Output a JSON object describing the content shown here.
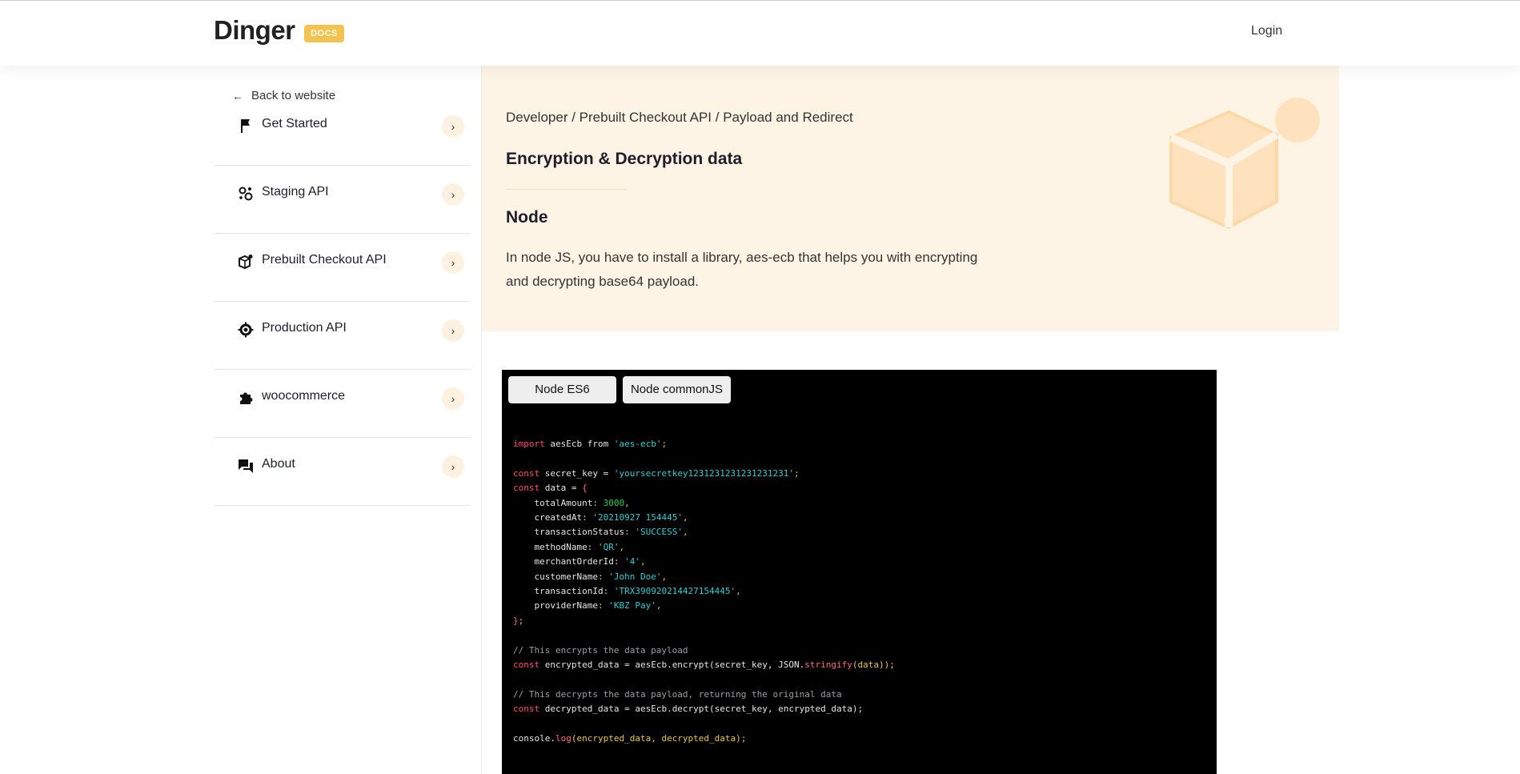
{
  "header": {
    "brand": "Dinger",
    "badge": "DOCS",
    "login": "Login"
  },
  "sidebar": {
    "back": "Back to website",
    "items": [
      {
        "label": "Get Started",
        "icon": "flag-icon"
      },
      {
        "label": "Staging API",
        "icon": "gears-icon"
      },
      {
        "label": "Prebuilt Checkout API",
        "icon": "package-icon"
      },
      {
        "label": "Production API",
        "icon": "gear-icon"
      },
      {
        "label": "woocommerce",
        "icon": "puzzle-icon"
      },
      {
        "label": "About",
        "icon": "chat-icon"
      }
    ]
  },
  "hero": {
    "breadcrumb": "Developer / Prebuilt Checkout API / Payload and Redirect",
    "title": "Encryption & Decryption data",
    "subtitle": "Node",
    "description": "In node JS, you have to install a library, aes-ecb that helps you with encrypting and decrypting base64 payload."
  },
  "code": {
    "tabs": [
      "Node ES6",
      "Node commonJS"
    ],
    "lines": {
      "import_kw": "import",
      "import_name": " aesEcb from ",
      "import_mod": "'aes-ecb'",
      "const": "const",
      "secret_name": " secret_key = ",
      "secret_val": "'yoursecretkey1231231231231231231'",
      "data_name": " data = ",
      "k_totalAmount": "totalAmount",
      "v_totalAmount": "3000",
      "k_createdAt": "createdAt",
      "v_createdAt": "'20210927 154445'",
      "k_transactionStatus": "transactionStatus",
      "v_transactionStatus": "'SUCCESS'",
      "k_methodName": "methodName",
      "v_methodName": "'QR'",
      "k_merchantOrderId": "merchantOrderId",
      "v_merchantOrderId": "'4'",
      "k_customerName": "customerName",
      "v_customerName": "'John Doe'",
      "k_transactionId": "transactionId",
      "v_transactionId": "'TRX390920214427154445'",
      "k_providerName": "providerName",
      "v_providerName": "'KBZ Pay'",
      "comment_encrypt": "// This encrypts the data payload",
      "enc_a": " encrypted_data = aesEcb.encrypt(secret_key, JSON.",
      "stringify": "stringify",
      "enc_b": "(data));",
      "comment_decrypt": "// This decrypts the data payload, returning the original data",
      "dec_a": " decrypted_data = aesEcb.decrypt(secret_key, encrypted_data);",
      "console": "console.",
      "log": "log",
      "log_args": "(encrypted_data, decrypted_data);"
    }
  },
  "colors": {
    "accent": "#f3c24f",
    "hero_bg": "#fef4e6",
    "code_bg": "#000000"
  }
}
